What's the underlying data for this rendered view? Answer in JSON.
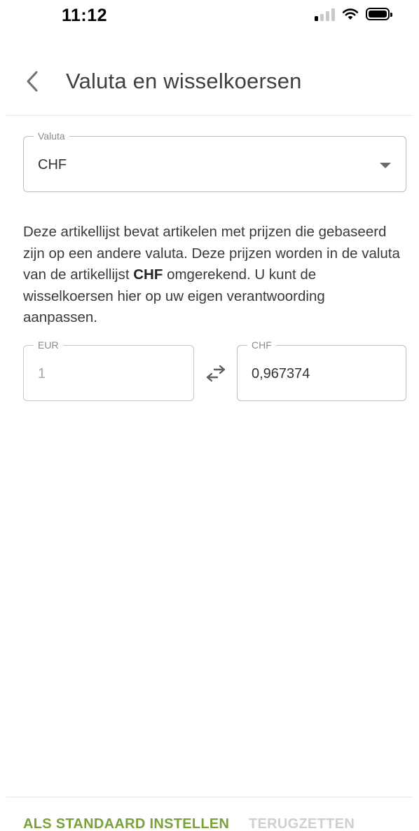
{
  "status_bar": {
    "time": "11:12"
  },
  "header": {
    "title": "Valuta en wisselkoersen"
  },
  "currency_select": {
    "label": "Valuta",
    "value": "CHF"
  },
  "description": {
    "text_before": "Deze artikellijst bevat artikelen met prijzen die gebaseerd zijn op een andere valuta. Deze prijzen worden in de valuta van de artikellijst ",
    "bold_currency": "CHF",
    "text_after": " omgerekend. U kunt de wisselkoersen hier op uw eigen verantwoording aanpassen."
  },
  "exchange": {
    "from_label": "EUR",
    "from_value": "1",
    "to_label": "CHF",
    "to_value": "0,967374"
  },
  "footer": {
    "set_default_label": "ALS STANDAARD INSTELLEN",
    "reset_label": "TERUGZETTEN"
  },
  "colors": {
    "accent": "#7ba13a",
    "disabled": "#cfcfcf"
  },
  "icons": {
    "back": "chevron-left-icon",
    "dropdown": "caret-down-icon",
    "swap": "swap-arrows-icon"
  }
}
